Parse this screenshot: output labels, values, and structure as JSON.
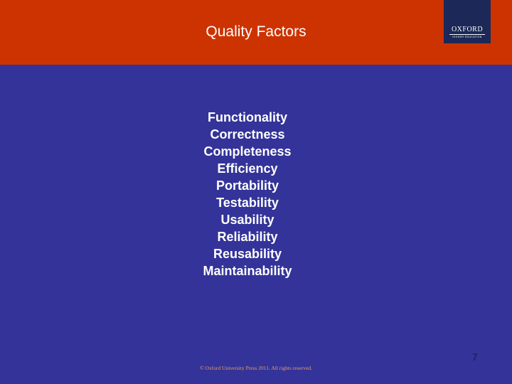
{
  "slide": {
    "title": "Quality Factors",
    "logo": {
      "name": "OXFORD",
      "subtitle": "HIGHER EDUCATION"
    },
    "items": [
      "Functionality",
      "Correctness",
      "Completeness",
      "Efficiency",
      "Portability",
      "Testability",
      "Usability",
      "Reliability",
      "Reusability",
      "Maintainability"
    ],
    "page_number": "7",
    "footer": "© Oxford University Press 2011. All rights reserved."
  },
  "colors": {
    "header": "#CC3300",
    "background": "#333399",
    "logo_background": "#1C2857",
    "text": "#FFFFFF",
    "footer_text": "#E8A060"
  }
}
